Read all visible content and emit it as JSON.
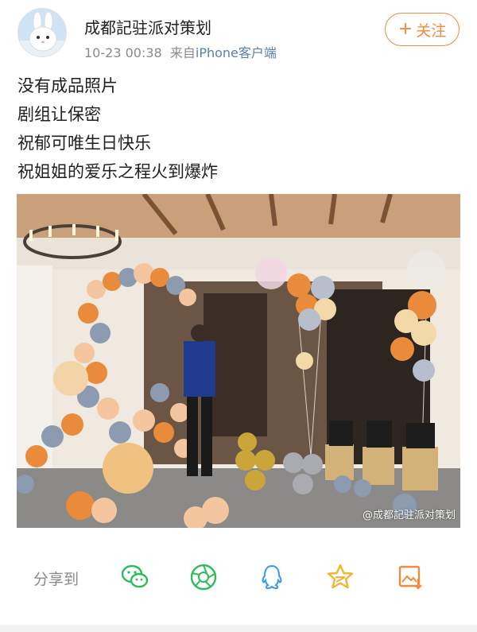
{
  "post": {
    "author": "成都記驻派对策划",
    "timestamp": "10-23 00:38",
    "source_prefix": "来自",
    "source": "iPhone客户端",
    "follow_label": "关注",
    "lines": [
      "没有成品照片",
      "剧组让保密",
      "祝郁可唯生日快乐",
      "祝姐姐的爱乐之程火到爆炸"
    ],
    "watermark": "@成都記驻派对策划"
  },
  "share": {
    "label": "分享到",
    "targets": [
      {
        "icon": "wechat-icon"
      },
      {
        "icon": "moments-icon"
      },
      {
        "icon": "qq-icon"
      },
      {
        "icon": "qzone-icon"
      },
      {
        "icon": "save-image-icon"
      }
    ]
  },
  "colors": {
    "accent": "#f08a3c",
    "link": "#5b7fa8",
    "share_green": "#2dbb5a",
    "share_blue": "#3e9de6",
    "share_yellow": "#f3b530",
    "share_orange": "#f08a3c"
  }
}
